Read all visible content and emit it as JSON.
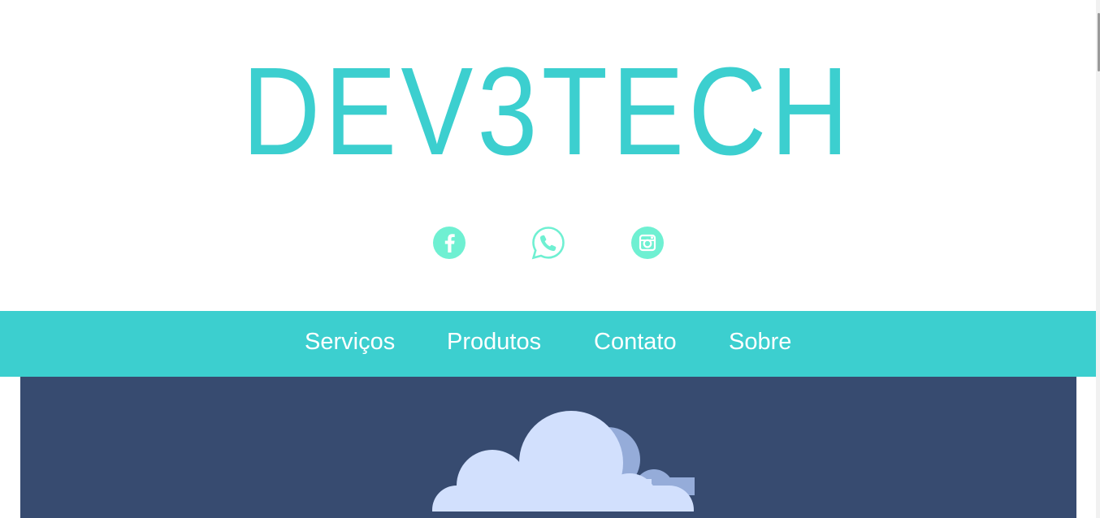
{
  "brand": {
    "logo_text": "DEV3TECH",
    "color": "#3ccfcf"
  },
  "social": [
    {
      "name": "facebook",
      "icon": "facebook-icon",
      "glyph": "f",
      "color": "#6ff0d2"
    },
    {
      "name": "whatsapp",
      "icon": "whatsapp-icon",
      "color": "#6ff0d2"
    },
    {
      "name": "instagram",
      "icon": "instagram-icon",
      "color": "#6ff0d2"
    }
  ],
  "nav": {
    "background": "#3ccfcf",
    "items": [
      {
        "label": "Serviços"
      },
      {
        "label": "Produtos"
      },
      {
        "label": "Contato"
      },
      {
        "label": "Sobre"
      }
    ]
  },
  "hero": {
    "background": "#374b70",
    "illustration": "cloud-icon"
  }
}
